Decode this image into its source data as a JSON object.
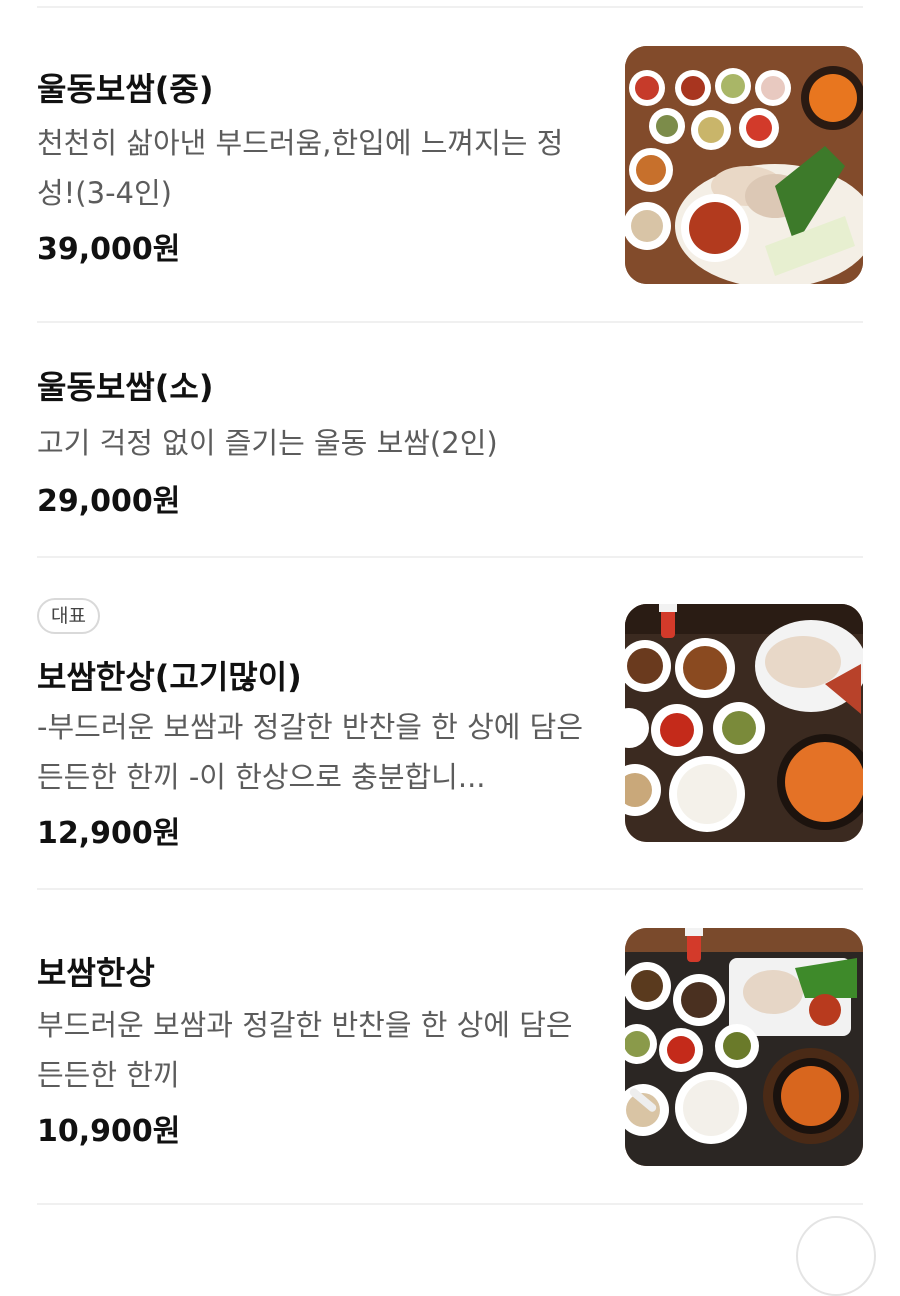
{
  "menu": {
    "items": [
      {
        "name": "울동보쌈(중)",
        "description": "천천히 삶아낸 부드러움,한입에 느껴지는 정성!(3-4인)",
        "price": "39,000원",
        "badge": "",
        "image": "bossam-platter-photo"
      },
      {
        "name": "울동보쌈(소)",
        "description": "고기 걱정 없이 즐기는 울동 보쌈(2인)",
        "price": "29,000원",
        "badge": "",
        "image": ""
      },
      {
        "name": "보쌈한상(고기많이)",
        "description": "-부드러운 보쌈과 정갈한 반찬을 한 상에 담은 든든한 한끼 -이 한상으로 충분합니...",
        "price": "12,900원",
        "badge": "대표",
        "image": "bossam-set-large-photo"
      },
      {
        "name": "보쌈한상",
        "description": "부드러운 보쌈과 정갈한 반찬을 한 상에 담은 든든한 한끼",
        "price": "10,900원",
        "badge": "",
        "image": "bossam-set-photo"
      }
    ]
  },
  "colors": {
    "text_primary": "#111111",
    "text_secondary": "#5c5c5c",
    "divider": "#f0f0f0",
    "badge_border": "#d9d9d9"
  }
}
